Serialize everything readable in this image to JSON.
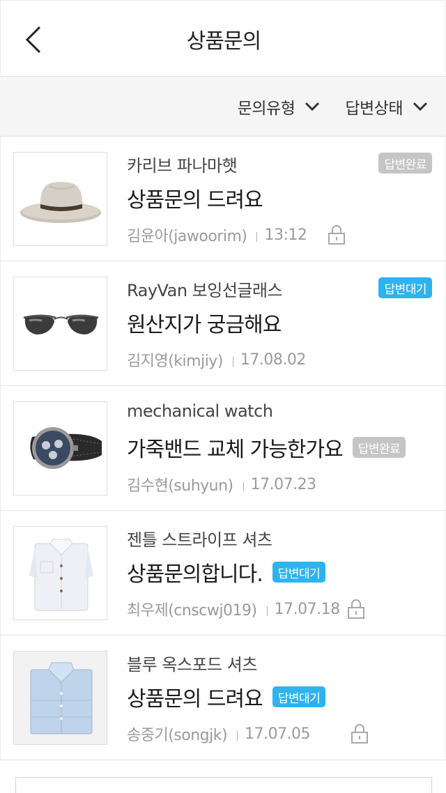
{
  "header": {
    "title": "상품문의",
    "back_icon": "chevron-left-icon"
  },
  "filters": [
    {
      "label": "문의유형",
      "icon": "chevron-down-icon"
    },
    {
      "label": "답변상태",
      "icon": "chevron-down-icon"
    }
  ],
  "colors": {
    "badge_done": "#c5c5c5",
    "badge_wait": "#2eb3f0"
  },
  "items": [
    {
      "product": "카리브 파나마햇",
      "question": "상품문의 드려요",
      "author": "김윤아(jawoorim)",
      "time": "13:12",
      "status": "답변완료",
      "image": "hat",
      "locked": true
    },
    {
      "product": "RayVan 보잉선글래스",
      "question": "원산지가 궁금해요",
      "author": "김지영(kimjiy)",
      "time": "17.08.02",
      "status": "답변대기",
      "image": "sunglasses",
      "locked": false
    },
    {
      "product": "mechanical watch",
      "question": "가죽밴드 교체 가능한가요",
      "author": "김수현(suhyun)",
      "time": "17.07.23",
      "status": "답변완료",
      "image": "watch",
      "locked": false
    },
    {
      "product": "젠틀 스트라이프 셔츠",
      "question": "상품문의합니다.",
      "author": "최우제(cnscwj019)",
      "time": "17.07.18",
      "status": "답변대기",
      "image": "white-shirt",
      "locked": true
    },
    {
      "product": "블루 옥스포드 셔츠",
      "question": "상품문의 드려요",
      "author": "송중기(songjk)",
      "time": "17.07.05",
      "status": "답변대기",
      "image": "blue-shirt",
      "locked": true
    }
  ]
}
